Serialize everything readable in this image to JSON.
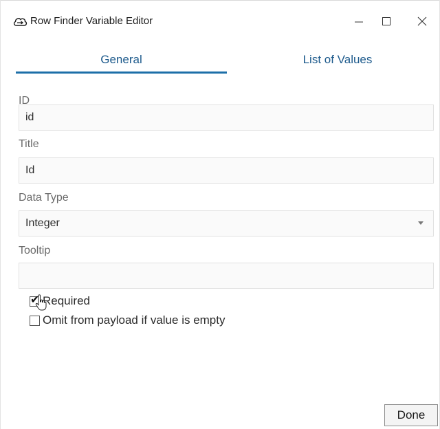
{
  "window": {
    "title": "Row Finder Variable Editor",
    "icon": "cloud-app-icon"
  },
  "tabs": [
    {
      "label": "General",
      "active": true
    },
    {
      "label": "List of Values",
      "active": false
    }
  ],
  "form": {
    "id": {
      "label": "ID",
      "value": "id"
    },
    "title": {
      "label": "Title",
      "value": "Id"
    },
    "data_type": {
      "label": "Data Type",
      "value": "Integer"
    },
    "tooltip": {
      "label": "Tooltip",
      "value": ""
    },
    "required": {
      "label": "Required",
      "checked": true
    },
    "omit_payload": {
      "label": "Omit from payload if value is empty",
      "checked": false
    }
  },
  "buttons": {
    "done": "Done"
  },
  "colors": {
    "accent": "#1d6fa8",
    "tab_text": "#1d5a8c"
  }
}
